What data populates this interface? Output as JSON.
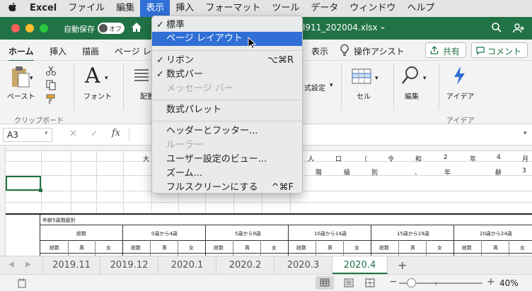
{
  "menubar": {
    "apple": "",
    "items": [
      "Excel",
      "ファイル",
      "編集",
      "表示",
      "挿入",
      "フォーマット",
      "ツール",
      "データ",
      "ウィンドウ",
      "ヘルプ"
    ],
    "active_index": 3
  },
  "titlebar": {
    "autosave_label": "自動保存",
    "autosave_state": "オフ",
    "filename_fragment": "l911_202004.xlsx",
    "filename_chevron": "⌄"
  },
  "ribbon_tabs": {
    "items": [
      "ホーム",
      "挿入",
      "描画",
      "ページ レ",
      "表示"
    ],
    "active_index": 0,
    "assist": "操作アシスト",
    "share": "共有",
    "comment": "コメント"
  },
  "ribbon": {
    "paste": "ペースト",
    "font": "フォント",
    "align_partial": "配置",
    "format_partial": "式設定",
    "cells": "セル",
    "edit": "編集",
    "ideas": "アイデア",
    "clipboard_group": "クリップボード",
    "ideas_group": "アイデア"
  },
  "formula": {
    "cell_ref": "A3",
    "fx": "fx",
    "cancel": "✕",
    "enter": "✓"
  },
  "dropdown": {
    "items": [
      {
        "label": "標準",
        "checked": true,
        "disabled": false,
        "highlighted": false,
        "shortcut": ""
      },
      {
        "label": "ページ レイアウト",
        "checked": false,
        "disabled": false,
        "highlighted": true,
        "shortcut": ""
      },
      {
        "label": "リボン",
        "checked": true,
        "disabled": false,
        "highlighted": false,
        "shortcut": "⌥⌘R"
      },
      {
        "label": "数式バー",
        "checked": true,
        "disabled": false,
        "highlighted": false,
        "shortcut": ""
      },
      {
        "label": "メッセージ バー",
        "checked": false,
        "disabled": true,
        "highlighted": false,
        "shortcut": ""
      },
      {
        "label": "数式パレット",
        "checked": false,
        "disabled": false,
        "highlighted": false,
        "shortcut": ""
      },
      {
        "label": "ヘッダーとフッター...",
        "checked": false,
        "disabled": false,
        "highlighted": false,
        "shortcut": ""
      },
      {
        "label": "ルーラー",
        "checked": false,
        "disabled": true,
        "highlighted": false,
        "shortcut": ""
      },
      {
        "label": "ユーザー設定のビュー...",
        "checked": false,
        "disabled": false,
        "highlighted": false,
        "shortcut": ""
      },
      {
        "label": "ズーム...",
        "checked": false,
        "disabled": false,
        "highlighted": false,
        "shortcut": ""
      },
      {
        "label": "フルスクリーンにする",
        "checked": false,
        "disabled": false,
        "highlighted": false,
        "shortcut": "^⌘F"
      }
    ]
  },
  "sheet": {
    "title_chars": [
      "大",
      "人",
      "口",
      "（",
      "令",
      "和",
      "2",
      "年",
      "4",
      "月"
    ],
    "subtitle_chars": [
      "階",
      "級",
      "別",
      "、",
      "年",
      "齢",
      "3"
    ],
    "section_label": "年齢5歳階級別",
    "col_header_total": "総数",
    "age_groups": [
      "0歳から4歳",
      "5歳から9歳",
      "10歳から14歳",
      "15歳から19歳",
      "20歳から24歳"
    ],
    "sub_headers": [
      "総数",
      "男",
      "女"
    ]
  },
  "sheet_tabs": {
    "items": [
      "2019.11",
      "2019.12",
      "2020.1",
      "2020.2",
      "2020.3",
      "2020.4"
    ],
    "active_index": 5,
    "add": "+"
  },
  "status": {
    "zoom": "40%",
    "minus": "−",
    "plus": "+"
  }
}
